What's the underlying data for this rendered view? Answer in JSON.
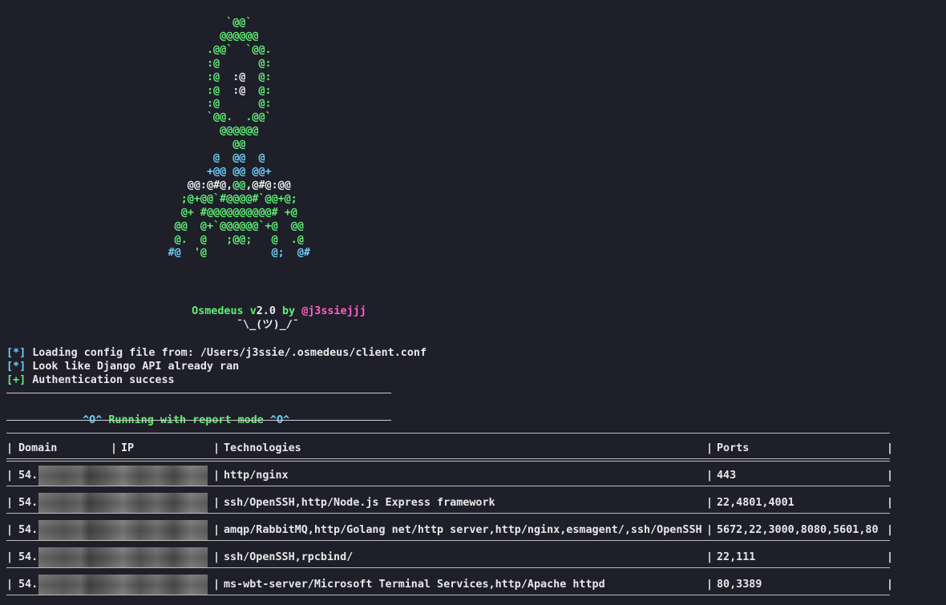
{
  "art_lines": [
    {
      "indent": "                                   ",
      "segments": [
        {
          "t": "`@@`",
          "c": "g"
        }
      ]
    },
    {
      "indent": "                                  ",
      "segments": [
        {
          "t": "@@@@@@",
          "c": "g"
        }
      ]
    },
    {
      "indent": "                                ",
      "segments": [
        {
          "t": ".@@`  `@@.",
          "c": "g"
        }
      ]
    },
    {
      "indent": "                                ",
      "segments": [
        {
          "t": ":@      @:",
          "c": "g"
        }
      ]
    },
    {
      "indent": "                                ",
      "segments": [
        {
          "t": ":@  ",
          "c": "g"
        },
        {
          "t": ":@",
          "c": "w"
        },
        {
          "t": "  @:",
          "c": "g"
        }
      ]
    },
    {
      "indent": "                                ",
      "segments": [
        {
          "t": ":@  ",
          "c": "g"
        },
        {
          "t": ":@",
          "c": "w"
        },
        {
          "t": "  @:",
          "c": "g"
        }
      ]
    },
    {
      "indent": "                                ",
      "segments": [
        {
          "t": ":@      @:",
          "c": "g"
        }
      ]
    },
    {
      "indent": "                                ",
      "segments": [
        {
          "t": "`@@.  .@@`",
          "c": "g"
        }
      ]
    },
    {
      "indent": "                                  ",
      "segments": [
        {
          "t": "@@@@@@",
          "c": "g"
        }
      ]
    },
    {
      "indent": "                                    ",
      "segments": [
        {
          "t": "@@",
          "c": "g"
        }
      ]
    },
    {
      "indent": "                                 ",
      "segments": [
        {
          "t": "@  @@  @",
          "c": "c"
        }
      ]
    },
    {
      "indent": "                                ",
      "segments": [
        {
          "t": "+@@ @@ @@+",
          "c": "c"
        }
      ]
    },
    {
      "indent": "                             ",
      "segments": [
        {
          "t": "@@:@#@,",
          "c": "w"
        },
        {
          "t": "@@",
          "c": "g"
        },
        {
          "t": ",@#@:@@",
          "c": "w"
        }
      ]
    },
    {
      "indent": "                            ",
      "segments": [
        {
          "t": ";@+@@`#@@@@#`@@+@;",
          "c": "g"
        }
      ]
    },
    {
      "indent": "                            ",
      "segments": [
        {
          "t": "@+ #@@@@@@@@@@# +@",
          "c": "g"
        }
      ]
    },
    {
      "indent": "                           ",
      "segments": [
        {
          "t": "@@  @+`@@@@@@`+@  @@",
          "c": "g"
        }
      ]
    },
    {
      "indent": "                           ",
      "segments": [
        {
          "t": "@.  @   ;@@;   @  .@",
          "c": "g"
        }
      ]
    },
    {
      "indent": "                          ",
      "segments": [
        {
          "t": "#@",
          "c": "c"
        },
        {
          "t": "  '@          ",
          "c": "g"
        },
        {
          "t": "@;",
          "c": "c"
        },
        {
          "t": "  @#",
          "c": "c"
        }
      ]
    }
  ],
  "banner": {
    "name": "Osmedeus",
    "v": "v",
    "version": "2.0",
    "by": "by",
    "author": "@j3ssiejjj",
    "shrug": "¯\\_(ツ)_/¯"
  },
  "log": [
    {
      "prefix": "[*]",
      "text": " Loading config file from: /Users/j3ssie/.osmedeus/client.conf",
      "color": "#6fd0f8"
    },
    {
      "prefix": "[*]",
      "text": " Look like Django API already ran",
      "color": "#6fd0f8"
    },
    {
      "prefix": "[+]",
      "text": " Authentication success",
      "color": "#5ff076"
    }
  ],
  "mode_banner": {
    "left": "^O^",
    "text": "Running with report mode",
    "right": "^O^"
  },
  "table": {
    "headers": [
      "Domain",
      "IP",
      "Technologies",
      "Ports"
    ],
    "rows": [
      {
        "domain": "54.",
        "tech": "http/nginx",
        "ports": "443"
      },
      {
        "domain": "54.",
        "tech": "ssh/OpenSSH,http/Node.js Express framework",
        "ports": "22,4801,4001"
      },
      {
        "domain": "54.",
        "tech": "amqp/RabbitMQ,http/Golang net/http server,http/nginx,esmagent/,ssh/OpenSSH",
        "ports": "5672,22,3000,8080,5601,80"
      },
      {
        "domain": "54.",
        "tech": "ssh/OpenSSH,rpcbind/",
        "ports": "22,111"
      },
      {
        "domain": "54.",
        "tech": "ms-wbt-server/Microsoft Terminal Services,http/Apache httpd",
        "ports": "80,3389"
      }
    ]
  }
}
